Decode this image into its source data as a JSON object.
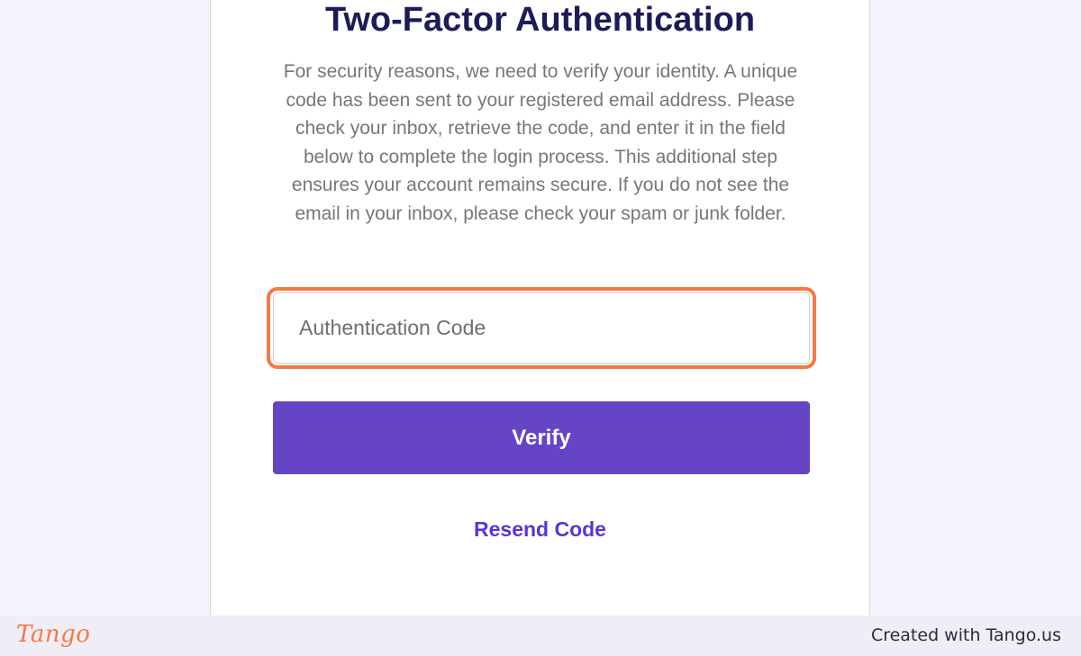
{
  "title": "Two-Factor Authentication",
  "description": "For security reasons, we need to verify your identity. A unique code has been sent to your registered email address. Please check your inbox, retrieve the code, and enter it in the field below to complete the login process. This additional step ensures your account remains secure. If you do not see the email in your inbox, please check your spam or junk folder.",
  "code_input": {
    "placeholder": "Authentication Code",
    "value": ""
  },
  "verify_label": "Verify",
  "resend_label": "Resend Code",
  "footer": {
    "logo_text": "Tango",
    "created_with": "Created with Tango.us"
  },
  "colors": {
    "page_background": "#f4f4fd",
    "title": "#1d1b58",
    "button": "#6545c6",
    "link": "#5a35d6",
    "highlight": "#f47a45",
    "footer_background": "#efedf5"
  }
}
